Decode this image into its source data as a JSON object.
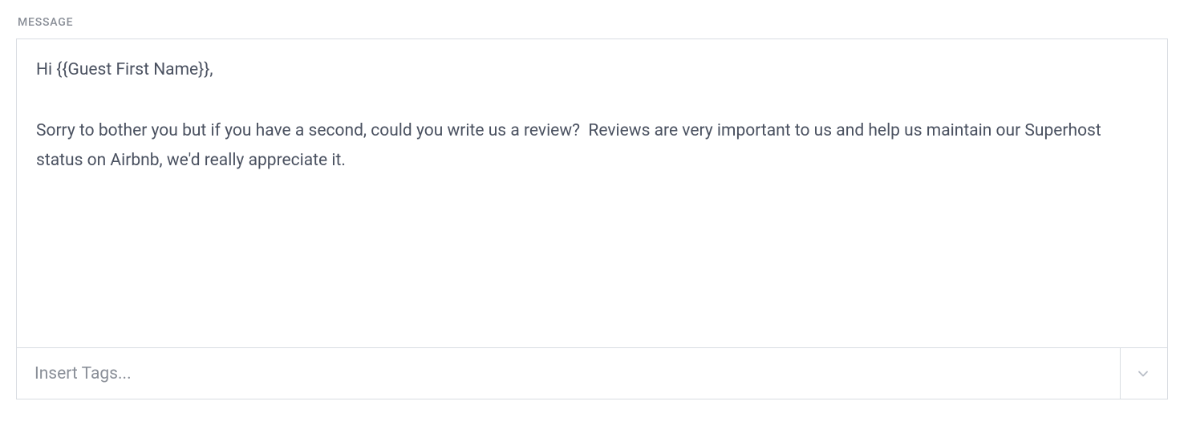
{
  "field": {
    "label": "MESSAGE"
  },
  "message": {
    "body": "Hi {{Guest First Name}},\n\nSorry to bother you but if you have a second, could you write us a review?  Reviews are very important to us and help us maintain our Superhost status on Airbnb, we'd really appreciate it."
  },
  "tags": {
    "placeholder": "Insert Tags..."
  }
}
